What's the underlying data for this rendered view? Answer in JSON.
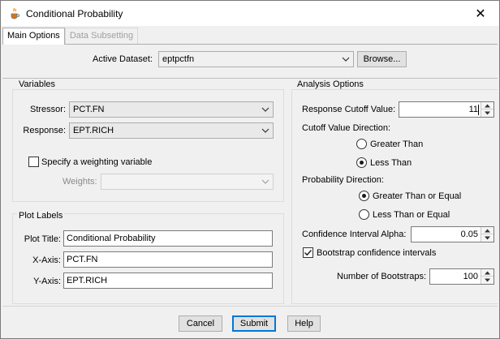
{
  "window": {
    "title": "Conditional Probability",
    "close_glyph": "✕"
  },
  "tabs": [
    {
      "label": "Main Options",
      "active": true
    },
    {
      "label": "Data Subsetting",
      "active": false
    }
  ],
  "dataset": {
    "label": "Active Dataset:",
    "value": "eptpctfn",
    "browse_label": "Browse..."
  },
  "variables": {
    "group_title": "Variables",
    "stressor_label": "Stressor:",
    "stressor_value": "PCT.FN",
    "response_label": "Response:",
    "response_value": "EPT.RICH",
    "weight_checkbox_label": "Specify a weighting variable",
    "weight_checked": false,
    "weights_label": "Weights:",
    "weights_value": ""
  },
  "plot_labels": {
    "group_title": "Plot Labels",
    "plot_title_label": "Plot Title:",
    "plot_title_value": "Conditional Probability",
    "xaxis_label": "X-Axis:",
    "xaxis_value": "PCT.FN",
    "yaxis_label": "Y-Axis:",
    "yaxis_value": "EPT.RICH"
  },
  "analysis": {
    "group_title": "Analysis Options",
    "cutoff_label": "Response Cutoff Value:",
    "cutoff_value": "11",
    "direction_label": "Cutoff Value Direction:",
    "direction_options": [
      {
        "label": "Greater Than",
        "selected": false
      },
      {
        "label": "Less Than",
        "selected": true
      }
    ],
    "prob_direction_label": "Probability Direction:",
    "prob_direction_options": [
      {
        "label": "Greater Than or Equal",
        "selected": true
      },
      {
        "label": "Less Than or Equal",
        "selected": false
      }
    ],
    "alpha_label": "Confidence Interval Alpha:",
    "alpha_value": "0.05",
    "bootstrap_label": "Bootstrap confidence intervals",
    "bootstrap_checked": true,
    "num_bootstraps_label": "Number of Bootstraps:",
    "num_bootstraps_value": "100"
  },
  "buttons": {
    "cancel": "Cancel",
    "submit": "Submit",
    "help": "Help"
  },
  "icons": {
    "app": "java-coffee-cup-icon",
    "dropdown": "chevron-down-icon",
    "spinner": "spinner-arrows-icon",
    "check": "check-icon"
  }
}
